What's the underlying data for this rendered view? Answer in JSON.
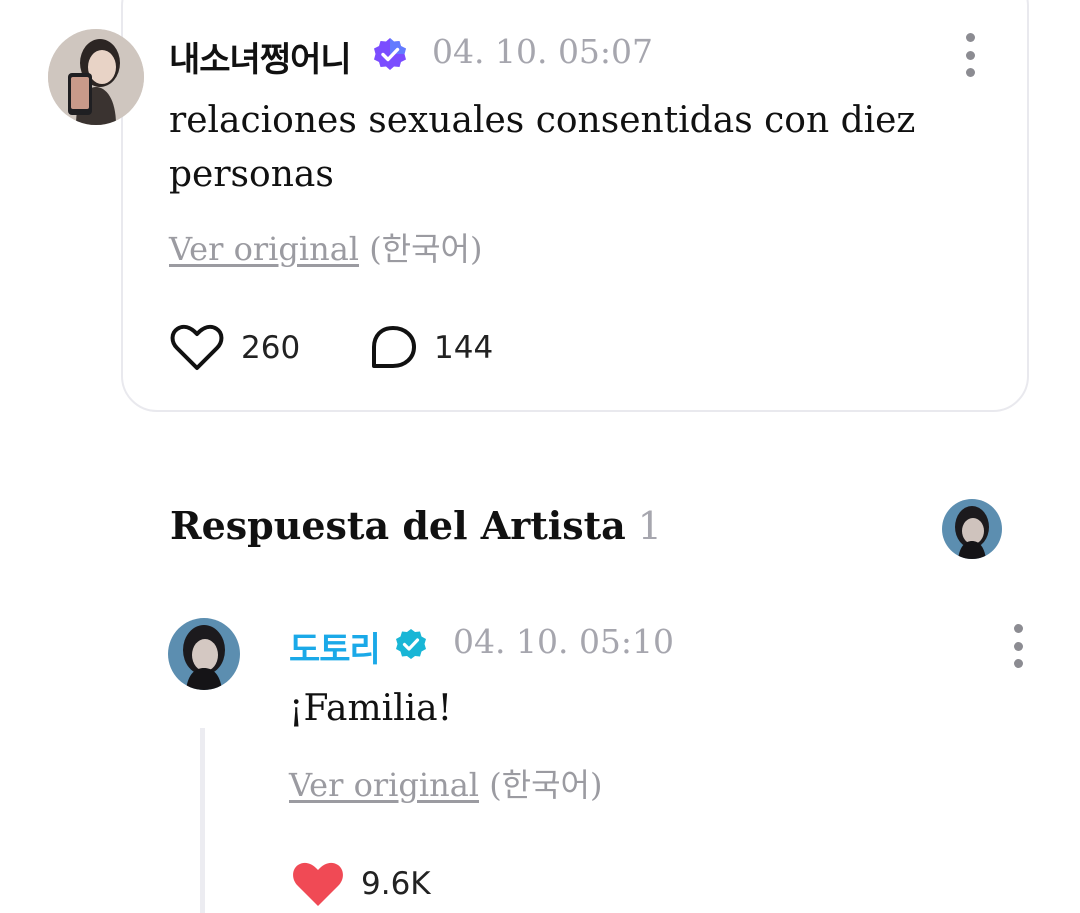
{
  "post": {
    "username": "내소녀쩡어니",
    "timestamp": "04. 10. 05:07",
    "text": "relaciones sexuales consentidas con diez personas",
    "translate_link": "Ver original",
    "translate_lang": "(한국어)",
    "likes": "260",
    "comments": "144",
    "verified_icon": "purple-verified-badge"
  },
  "artist_section": {
    "title": "Respuesta del Artista",
    "count": "1"
  },
  "reply": {
    "username": "도토리",
    "timestamp": "04. 10. 05:10",
    "text": "¡Familia!",
    "translate_link": "Ver original",
    "translate_lang": "(한국어)",
    "likes": "9.6K",
    "verified_icon": "teal-verified-badge"
  },
  "colors": {
    "artist_name": "#1aa9e8",
    "heart_liked": "#f04a55",
    "verified_purple": "#7b4dff",
    "verified_teal": "#19b6d6",
    "muted_text": "#a6a6ae"
  }
}
